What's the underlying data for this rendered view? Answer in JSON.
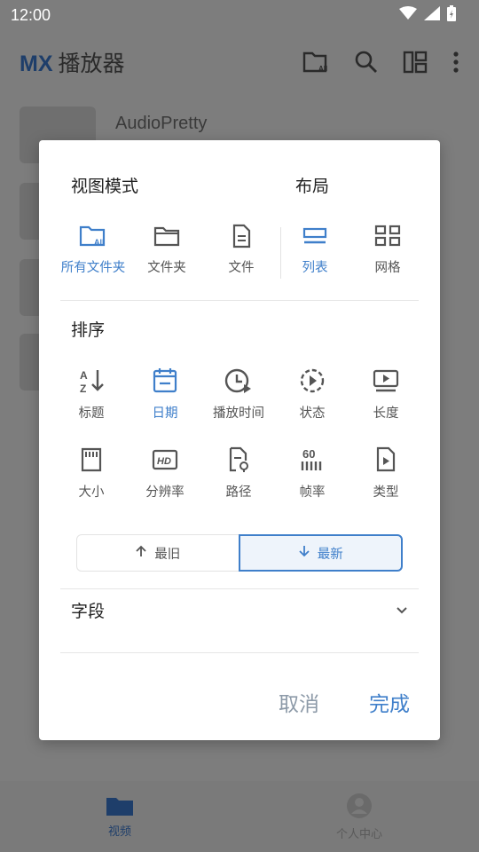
{
  "status_bar": {
    "time": "12:00"
  },
  "app_bar": {
    "logo": "MX",
    "title": "播放器"
  },
  "background_list": {
    "first_title": "AudioPretty"
  },
  "bottom_nav": {
    "videos": "视频",
    "profile": "个人中心"
  },
  "dialog": {
    "view_mode": {
      "title": "视图模式",
      "options": [
        {
          "label": "所有文件夹",
          "icon": "all-folders-icon",
          "selected": true
        },
        {
          "label": "文件夹",
          "icon": "folder-icon",
          "selected": false
        },
        {
          "label": "文件",
          "icon": "file-icon",
          "selected": false
        }
      ]
    },
    "layout": {
      "title": "布局",
      "options": [
        {
          "label": "列表",
          "icon": "list-icon",
          "selected": true
        },
        {
          "label": "网格",
          "icon": "grid-icon",
          "selected": false
        }
      ]
    },
    "sort": {
      "title": "排序",
      "options": [
        {
          "label": "标题",
          "icon": "sort-az-icon",
          "selected": false
        },
        {
          "label": "日期",
          "icon": "calendar-icon",
          "selected": true
        },
        {
          "label": "播放时间",
          "icon": "clock-play-icon",
          "selected": false
        },
        {
          "label": "状态",
          "icon": "status-play-icon",
          "selected": false
        },
        {
          "label": "长度",
          "icon": "length-icon",
          "selected": false
        },
        {
          "label": "大小",
          "icon": "sd-card-icon",
          "selected": false
        },
        {
          "label": "分辨率",
          "icon": "hd-icon",
          "selected": false
        },
        {
          "label": "路径",
          "icon": "path-icon",
          "selected": false
        },
        {
          "label": "帧率",
          "icon": "fps-60-icon",
          "selected": false
        },
        {
          "label": "类型",
          "icon": "type-icon",
          "selected": false
        }
      ],
      "order": {
        "oldest": "最旧",
        "newest": "最新",
        "selected": "newest"
      }
    },
    "fields": {
      "title": "字段"
    },
    "buttons": {
      "cancel": "取消",
      "done": "完成"
    }
  },
  "colors": {
    "accent": "#3f7fca",
    "icon_gray": "#555555",
    "cancel": "#8d9aa8",
    "logo_dark": "#1e3e6a"
  }
}
